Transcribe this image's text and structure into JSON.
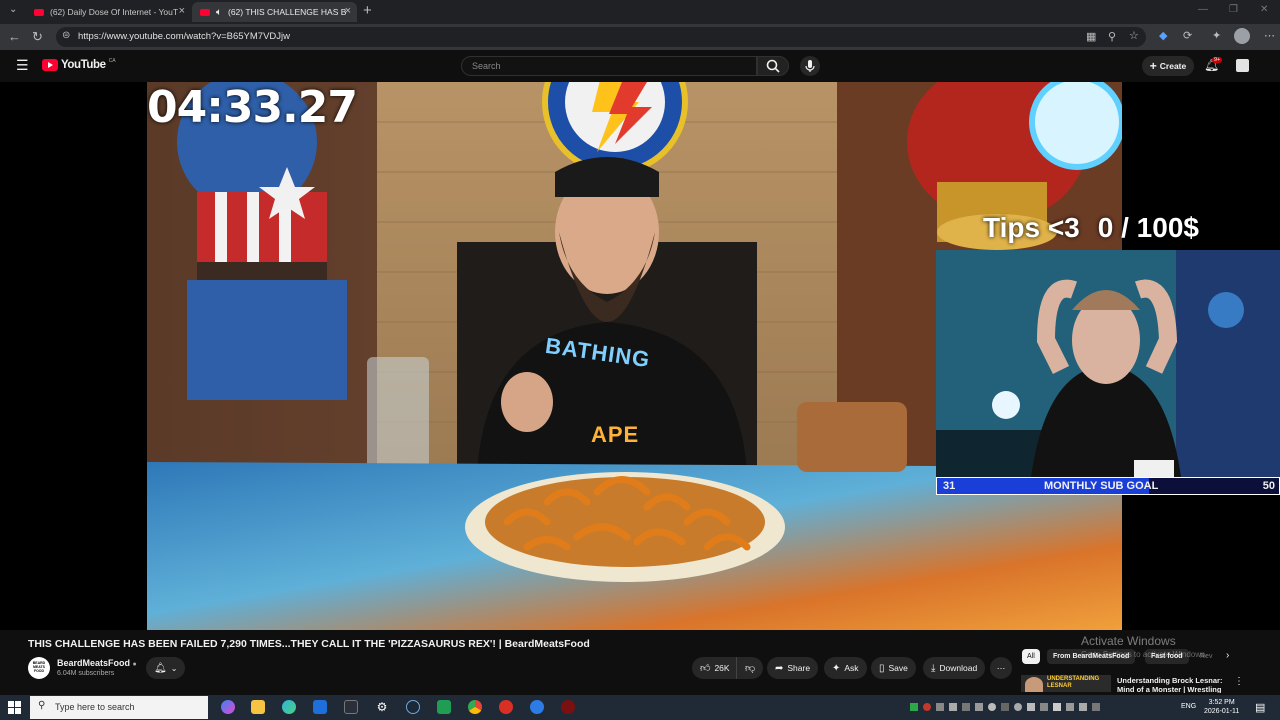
{
  "browser": {
    "tabs": [
      {
        "title": "(62) Daily Dose Of Internet - YouT",
        "active": false
      },
      {
        "title": "(62) THIS CHALLENGE HAS B",
        "active": true
      }
    ],
    "url": "https://www.youtube.com/watch?v=B65YM7VDJjw"
  },
  "youtube": {
    "logo_text": "YouTube",
    "country_code": "CA",
    "search_placeholder": "Search",
    "create_label": "Create",
    "notif_count": "9+"
  },
  "video": {
    "timer": "04:33.27",
    "tips_text": "Tips <3",
    "tips_goal": "0 / 100$",
    "sub_goal": {
      "current": "31",
      "label": "MONTHLY SUB GOAL",
      "target": "50"
    },
    "shirt_text_top": "BATHING",
    "shirt_text_bottom": "APE"
  },
  "info": {
    "title": "THIS CHALLENGE HAS BEEN FAILED 7,290 TIMES...THEY CALL IT THE 'PIZZASAURUS REX'! | BeardMeatsFood",
    "channel_name": "BeardMeatsFood",
    "subscribers": "6.04M subscribers",
    "avatar_text": "BEARD MEATS FOOD",
    "likes": "26K",
    "share_label": "Share",
    "ask_label": "Ask",
    "save_label": "Save",
    "download_label": "Download"
  },
  "sidebar": {
    "chips": [
      "All",
      "From BeardMeatsFood",
      "Fast food",
      "Rev"
    ],
    "rec_title": "Understanding Brock Lesnar: Mind of a Monster | Wrestling",
    "rec_thumb_text": "UNDERSTANDING LESNAR"
  },
  "watermark": {
    "line1": "Activate Windows",
    "line2": "Go to Settings to activate Windows."
  },
  "taskbar": {
    "search_placeholder": "Type here to search",
    "lang": "ENG",
    "time": "3:52 PM",
    "date": "2026-01-11"
  },
  "colors": {
    "yt_red": "#ff0033",
    "sub_goal_bar": "#1a3fd8",
    "page_bg": "#0f0f0f"
  }
}
